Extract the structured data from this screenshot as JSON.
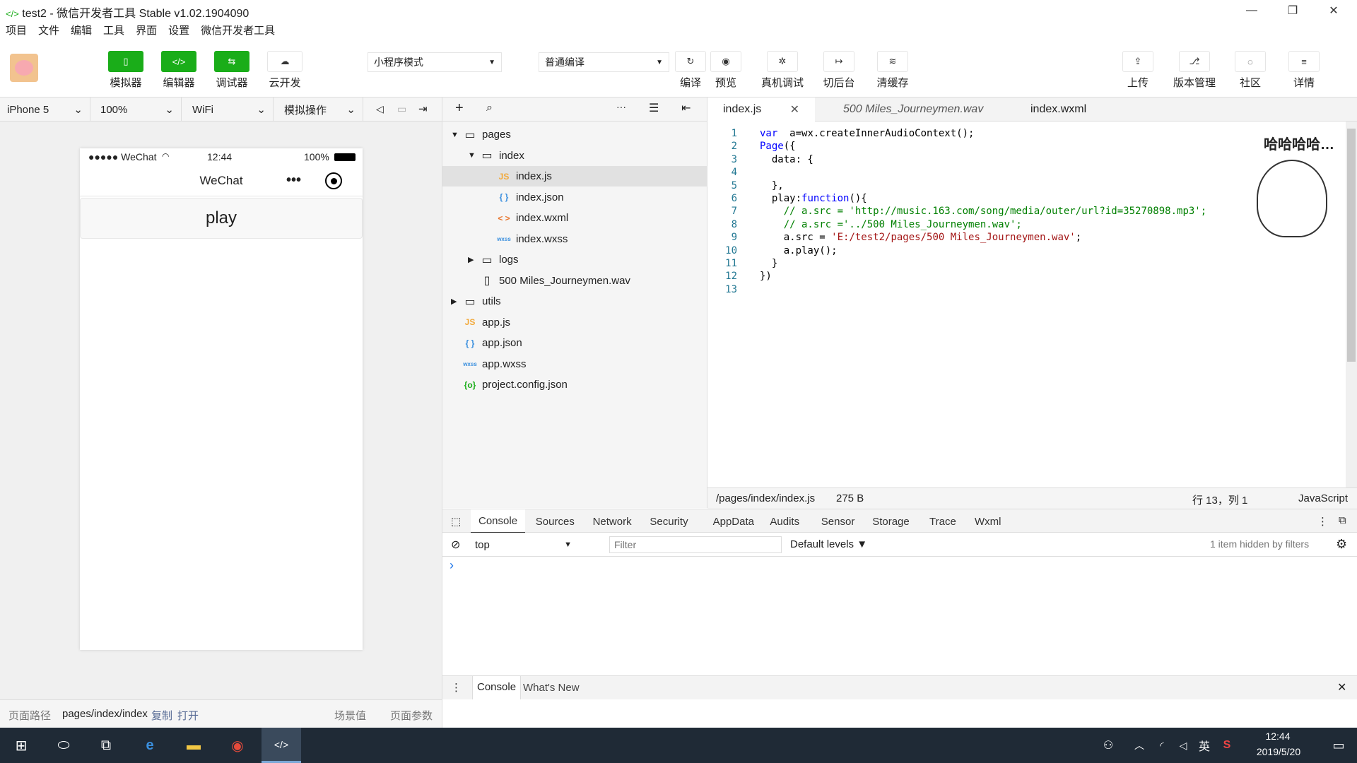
{
  "window": {
    "title": "test2 - 微信开发者工具 Stable v1.02.1904090",
    "buttons": [
      "—",
      "❐",
      "✕"
    ]
  },
  "menu": [
    "项目",
    "文件",
    "编辑",
    "工具",
    "界面",
    "设置",
    "微信开发者工具"
  ],
  "toolbar": {
    "left": [
      {
        "label": "模拟器",
        "icon": "phone-icon",
        "glyph": "▯"
      },
      {
        "label": "编辑器",
        "icon": "code-icon",
        "glyph": "</>"
      },
      {
        "label": "调试器",
        "icon": "debug-icon",
        "glyph": "⇆"
      },
      {
        "label": "云开发",
        "icon": "cloud-icon",
        "glyph": "☁"
      }
    ],
    "mode_select": "小程序模式",
    "compile_select": "普通编译",
    "middle": [
      {
        "label": "编译",
        "icon": "refresh-icon",
        "glyph": "↻"
      },
      {
        "label": "预览",
        "icon": "eye-icon",
        "glyph": "◉"
      },
      {
        "label": "真机调试",
        "icon": "bug-icon",
        "glyph": "✲"
      },
      {
        "label": "切后台",
        "icon": "switch-icon",
        "glyph": "↦"
      },
      {
        "label": "清缓存",
        "icon": "layers-icon",
        "glyph": "≋"
      }
    ],
    "right": [
      {
        "label": "上传",
        "icon": "upload-icon",
        "glyph": "⇪"
      },
      {
        "label": "版本管理",
        "icon": "branch-icon",
        "glyph": "⎇"
      },
      {
        "label": "社区",
        "icon": "chat-icon",
        "glyph": "◌"
      },
      {
        "label": "详情",
        "icon": "menu-icon",
        "glyph": "≡"
      }
    ]
  },
  "simulator": {
    "device": "iPhone 5",
    "zoom": "100%",
    "network": "WiFi",
    "ops": "模拟操作",
    "status": {
      "carrier": "●●●●● WeChat",
      "time": "12:44",
      "battery": "100%"
    },
    "nav_title": "WeChat",
    "play_label": "play",
    "footer": {
      "path_label": "页面路径",
      "path": "pages/index/index",
      "copy": "复制",
      "open": "打开",
      "scene": "场景值",
      "params": "页面参数"
    }
  },
  "tree": [
    {
      "name": "pages",
      "type": "folder",
      "depth": 0,
      "arrow": "▼"
    },
    {
      "name": "index",
      "type": "folder",
      "depth": 1,
      "arrow": "▼"
    },
    {
      "name": "index.js",
      "type": "js",
      "depth": 2,
      "active": true
    },
    {
      "name": "index.json",
      "type": "json",
      "depth": 2
    },
    {
      "name": "index.wxml",
      "type": "wxml",
      "depth": 2
    },
    {
      "name": "index.wxss",
      "type": "wxss",
      "depth": 2
    },
    {
      "name": "logs",
      "type": "folder",
      "depth": 1,
      "arrow": "▶"
    },
    {
      "name": "500 Miles_Journeymen.wav",
      "type": "file",
      "depth": 1
    },
    {
      "name": "utils",
      "type": "folder",
      "depth": 0,
      "arrow": "▶"
    },
    {
      "name": "app.js",
      "type": "js",
      "depth": 0
    },
    {
      "name": "app.json",
      "type": "json",
      "depth": 0
    },
    {
      "name": "app.wxss",
      "type": "wxss",
      "depth": 0
    },
    {
      "name": "project.config.json",
      "type": "config",
      "depth": 0
    }
  ],
  "tabs": [
    {
      "label": "index.js",
      "active": true
    },
    {
      "label": "500 Miles_Journeymen.wav",
      "italic": true
    },
    {
      "label": "index.wxml"
    }
  ],
  "code": [
    [
      [
        "kw",
        "var"
      ],
      [
        "",
        "  a=wx.createInnerAudioContext();"
      ]
    ],
    [
      [
        "kw",
        "Page"
      ],
      [
        "",
        "({"
      ]
    ],
    [
      [
        "",
        "  data: {"
      ]
    ],
    [
      [
        "",
        ""
      ]
    ],
    [
      [
        "",
        "  },"
      ]
    ],
    [
      [
        "",
        "  play:"
      ],
      [
        "kw",
        "function"
      ],
      [
        "",
        "(){"
      ]
    ],
    [
      [
        "cm",
        "    // a.src = 'http://music.163.com/song/media/outer/url?id=35270898.mp3';"
      ]
    ],
    [
      [
        "cm",
        "    // a.src ='../500 Miles_Journeymen.wav';"
      ]
    ],
    [
      [
        "",
        "    a.src = "
      ],
      [
        "st",
        "'E:/test2/pages/500 Miles_Journeymen.wav'"
      ],
      [
        "",
        ";"
      ]
    ],
    [
      [
        "",
        "    a.play();"
      ]
    ],
    [
      [
        "",
        "  }"
      ]
    ],
    [
      [
        "",
        "})"
      ]
    ],
    [
      [
        "",
        ""
      ]
    ]
  ],
  "sticker": "哈哈哈哈…",
  "editor_status": {
    "path": "/pages/index/index.js",
    "size": "275 B",
    "pos": "行 13，列 1",
    "lang": "JavaScript"
  },
  "devtools": {
    "tabs": [
      "Console",
      "Sources",
      "Network",
      "Security",
      "AppData",
      "Audits",
      "Sensor",
      "Storage",
      "Trace",
      "Wxml"
    ],
    "context": "top",
    "filter_placeholder": "Filter",
    "levels": "Default levels ▼",
    "hidden": "1 item hidden by filters",
    "prompt": "›",
    "drawer": [
      "Console",
      "What's New"
    ]
  },
  "taskbar": {
    "time": "12:44",
    "date": "2019/5/20",
    "ime": "英"
  }
}
